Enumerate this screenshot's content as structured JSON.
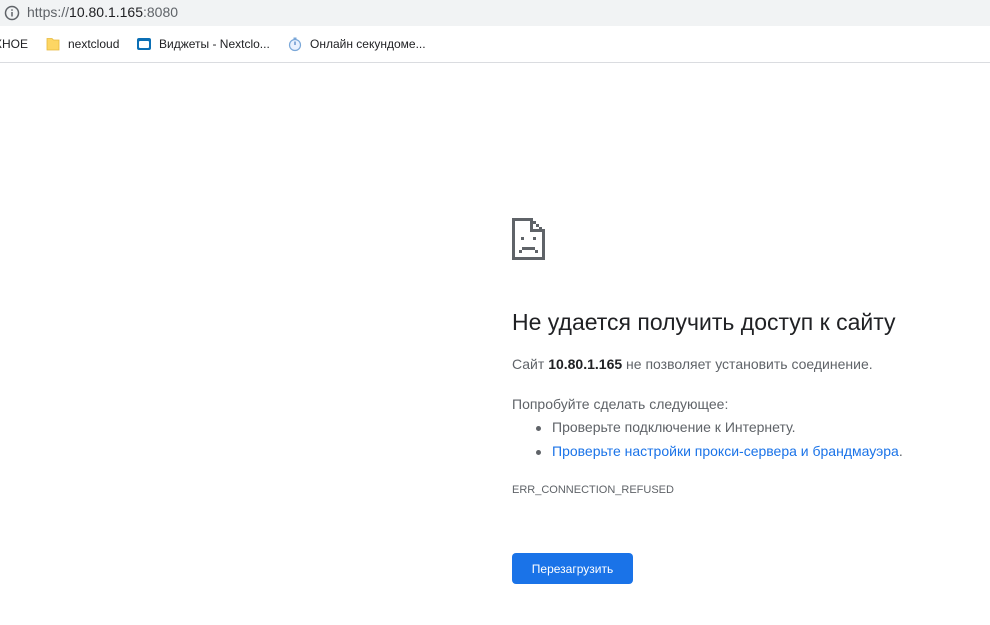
{
  "omnibox": {
    "scheme": "https://",
    "host": "10.80.1.165",
    "port": ":8080"
  },
  "bookmarks": [
    {
      "label": "ХНОЕ",
      "icon": "none"
    },
    {
      "label": "nextcloud",
      "icon": "folder-icon"
    },
    {
      "label": "Виджеты - Nextclo...",
      "icon": "nextcloud-favicon"
    },
    {
      "label": "Онлайн секундоме...",
      "icon": "stopwatch-favicon"
    }
  ],
  "error": {
    "title": "Не удается получить доступ к сайту",
    "site_prefix": "Сайт",
    "site_host": "10.80.1.165",
    "site_suffix": "не позволяет установить соединение.",
    "try_heading": "Попробуйте сделать следующее:",
    "suggestion_1": "Проверьте подключение к Интернету.",
    "suggestion_2_link": "Проверьте настройки прокси-сервера и брандмауэра",
    "suggestion_2_tail": ".",
    "code": "ERR_CONNECTION_REFUSED",
    "reload_label": "Перезагрузить"
  },
  "colors": {
    "accent": "#1a73e8",
    "text": "#202124",
    "secondary_text": "#5f6368",
    "omnibox_bg": "#f1f3f4"
  }
}
